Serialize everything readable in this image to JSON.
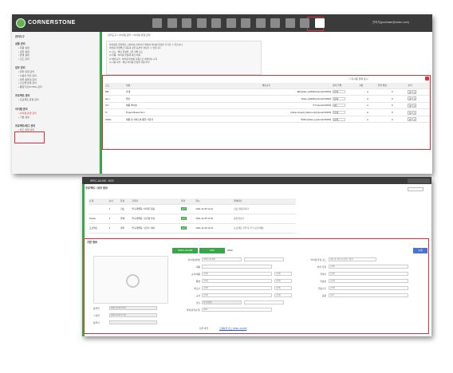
{
  "app": {
    "logo_text": "CORNERSTONE",
    "user_text": "관리자(purchase@cotec.com)"
  },
  "top_icons": [
    "box-icon",
    "grid-icon",
    "briefcase-icon",
    "calculator-icon",
    "chart-icon",
    "tools-icon",
    "list-icon",
    "document-icon",
    "cart-icon",
    "image-icon",
    "people-icon",
    "admin-user-icon"
  ],
  "sidebar": {
    "title": "관리도구",
    "sections": [
      {
        "title": "공통 관리",
        "items": [
          "회원 설정",
          "권한 설정",
          "환경 설정",
          "코드 관리"
        ]
      },
      {
        "title": "업무 관리",
        "items": [
          "업무 유형 관리",
          "사용자 역할 관리",
          "업무 템플릿 관리",
          "산출물 유형 관리",
          "통합기관(CTMS) 관리"
        ]
      },
      {
        "title": "프로젝트 관리",
        "items": [
          "프로젝트 유형 관리"
        ]
      },
      {
        "title": "아이템 관리",
        "items": [
          "아이템 유형 관리",
          "기본 설정"
        ]
      },
      {
        "title": "프로젝트/태그 관리",
        "items": [
          "태그 유형 관리"
        ]
      }
    ],
    "selected": "아이템 유형 관리"
  },
  "breadcrumb": "관리도구 > 아이템 관리 > 아이템 유형 관리",
  "notes": [
    "아이템을 유형별로 구분하여 관리하기 위하여 아이템 유형을 추가할 수 있습니다.",
    "아이템 유형별로 다음과 같은 옵션을 설정할 수 있습니다.",
    "1) 코드 : 해당 유형의 고유 식별 코드",
    "2) 이름 : 아이템 유형에 대한 이름",
    "3) 채번규칙 : 아이템 번호를 자동으로 생성하는 규칙",
    "4) 사용 여부 : 해당 아이템 유형의 사용 여부"
  ],
  "table": {
    "check_label": "미사용 항목 표시",
    "headers": [
      "코드",
      "이름",
      "채번규칙",
      "문서 연결",
      "사용",
      "일괄 배정",
      "관리"
    ],
    "rows": [
      {
        "code": "BM",
        "name": "자재",
        "rule": "BM-[Date:yyMMdd]-[Serial:NNNN]",
        "opt": "(선택)",
        "use": "●",
        "x": "✕"
      },
      {
        "code": "Item",
        "name": "일반",
        "rule": "[Date:yyMMdd]-[Serial:NNNN]",
        "opt": "(선택)",
        "use": "●",
        "x": "✕"
      },
      {
        "code": "ITC",
        "name": "제품 아이템",
        "rule": "ITC-[Serial:NNNN]",
        "opt": "제안",
        "use": "●",
        "x": "✕"
      },
      {
        "code": "PI",
        "name": "Project Based Item",
        "rule": "[Value:project]-[Value:unit]-[Serial:NNNN]",
        "opt": "(선택)",
        "use": "●",
        "x": "✕"
      },
      {
        "code": "SPEC",
        "name": "제품 및 서비스의 품질 기준서",
        "rule": "SPEC-[Date:yy]-[Serial:NNNN]",
        "opt": "(선택)",
        "use": "●",
        "x": "✕"
      }
    ]
  },
  "card2": {
    "title": "SPEC-18-008 · 2022",
    "section1": "프로젝트 / 워크 정보",
    "approval_headers": [
      "단계",
      "순서",
      "유형",
      "진행자",
      "결과",
      "일시",
      "결재의견"
    ],
    "approvals": [
      {
        "step": "",
        "ord": "1",
        "type": "검토",
        "who": "연구개발팀 / 이태현 팀장",
        "res": "승인",
        "date": "2021-11-05 11:41",
        "cmt": "검토 완료합니다"
      },
      {
        "step": "Define",
        "ord": "2",
        "type": "결재",
        "who": "연구개발팀 / 김진영 부장",
        "res": "승인",
        "date": "2021-11-05 11:53",
        "cmt": "승인합니다"
      },
      {
        "step": "프로젝트",
        "ord": "3",
        "type": "합의",
        "who": "연구개발팀 / 김철수 대리",
        "res": "승인",
        "date": "2021-11-05 12:01",
        "cmt": "프로젝트 진행 후 추가 조치 예정"
      }
    ],
    "section2": "기본 정보",
    "spec_code": "SPEC-18-008",
    "spec_ver": "000",
    "spec_year": "2022",
    "edit_label": "수정",
    "left_meta": [
      {
        "label": "등록일",
        "value": "2022-01-05 10:20"
      },
      {
        "label": "수정일",
        "value": "2022-01-06 17:34"
      },
      {
        "label": "등록자",
        "value": ""
      }
    ],
    "fields_left": [
      {
        "label": "관리대상번호",
        "value": "SPEC-18-008"
      },
      {
        "label": "제품",
        "value": ""
      },
      {
        "label": "규격/제품",
        "value": "(선택)"
      },
      {
        "label": "품명",
        "value": "(선택)"
      },
      {
        "label": "제조사",
        "value": "(선택)"
      },
      {
        "label": "규격",
        "value": "(선택)"
      },
      {
        "label": "담당",
        "value": "연구개발팀"
      },
      {
        "label": "설명(관리사유)",
        "value": "2022"
      }
    ],
    "fields_right": [
      {
        "label": "아이템 유형 코드",
        "value": "제품 및 서비스의 품질 기준서"
      },
      {
        "label": "버전 유형",
        "value": "(선택)"
      },
      {
        "label": "협력사",
        "value": "(선택)"
      },
      {
        "label": "유효성",
        "value": "(선택)"
      },
      {
        "label": "유효기간",
        "value": "(선택)"
      },
      {
        "label": "중량",
        "value": "0.00"
      }
    ],
    "attach_label": "첨부 파일",
    "attach_value": "스펙분류 태그 SPEC-18-008"
  }
}
